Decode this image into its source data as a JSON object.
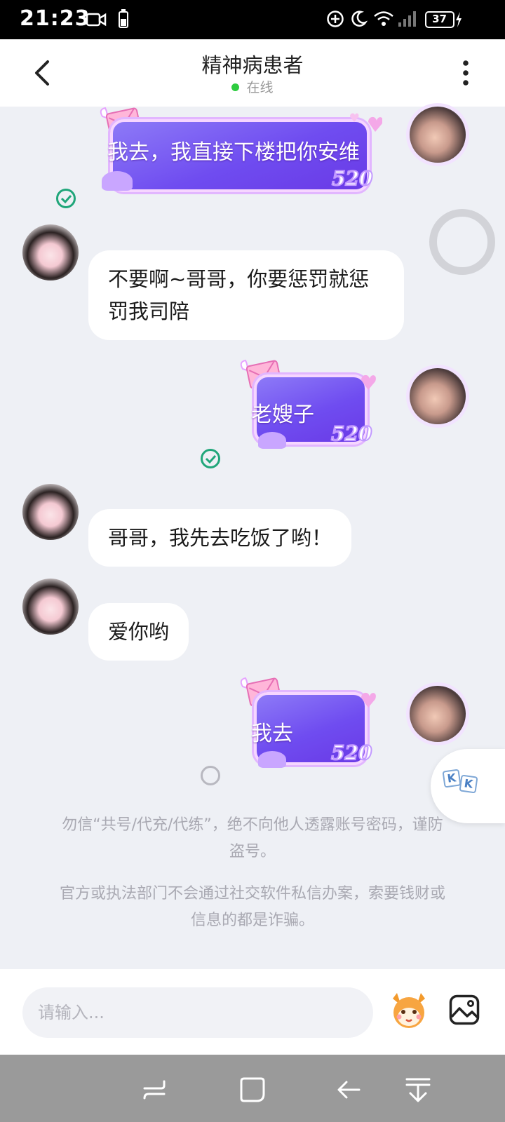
{
  "status_bar": {
    "time": "21:23",
    "battery": "37",
    "icons": [
      "video-camera-icon",
      "battery-small-icon",
      "plus-circle-icon",
      "moon-icon",
      "wifi-icon",
      "signal-icon",
      "battery-icon",
      "charging-bolt-icon"
    ]
  },
  "header": {
    "title": "精神病患者",
    "status": "在线",
    "status_color": "#2ecc40",
    "back_icon": "chevron-left-icon",
    "menu_icon": "more-vertical-icon"
  },
  "messages": [
    {
      "side": "right",
      "type": "gift",
      "text": "我去，我直接下楼把你安维",
      "badge": "520",
      "status": "sent"
    },
    {
      "side": "left",
      "type": "text",
      "lines": [
        "不要啊~哥哥，你要惩罚就惩",
        "罚我司陪"
      ]
    },
    {
      "side": "right",
      "type": "gift",
      "text": "老嫂子",
      "badge": "520",
      "status": "sent"
    },
    {
      "side": "left",
      "type": "text",
      "lines": [
        "哥哥，我先去吃饭了哟！"
      ]
    },
    {
      "side": "left",
      "type": "text",
      "lines": [
        "爱你哟"
      ]
    },
    {
      "side": "right",
      "type": "gift",
      "text": "我去",
      "badge": "520",
      "status": "sending"
    }
  ],
  "notices": {
    "account": [
      "勿信“共号/代充/代练”，绝不向他人透露账号密码，谨防",
      "盗号。"
    ],
    "fraud": [
      "官方或执法部门不会通过社交软件私信办案，索要钱财或",
      "信息的都是诈骗。"
    ]
  },
  "floating": {
    "assistive_icon": "floating-ring-icon",
    "keyboard_icon": "kk-keyboard-icon"
  },
  "input": {
    "placeholder": "请输入...",
    "emoji_icon": "fox-emoji-icon",
    "image_icon": "image-icon"
  },
  "nav_bar": {
    "icons": [
      "recent-apps-icon",
      "home-icon",
      "back-icon",
      "hide-nav-icon"
    ]
  },
  "colors": {
    "accent_green": "#20a67a",
    "gift_purple": "#6f4cf0",
    "chat_bg": "#eef0f5"
  }
}
